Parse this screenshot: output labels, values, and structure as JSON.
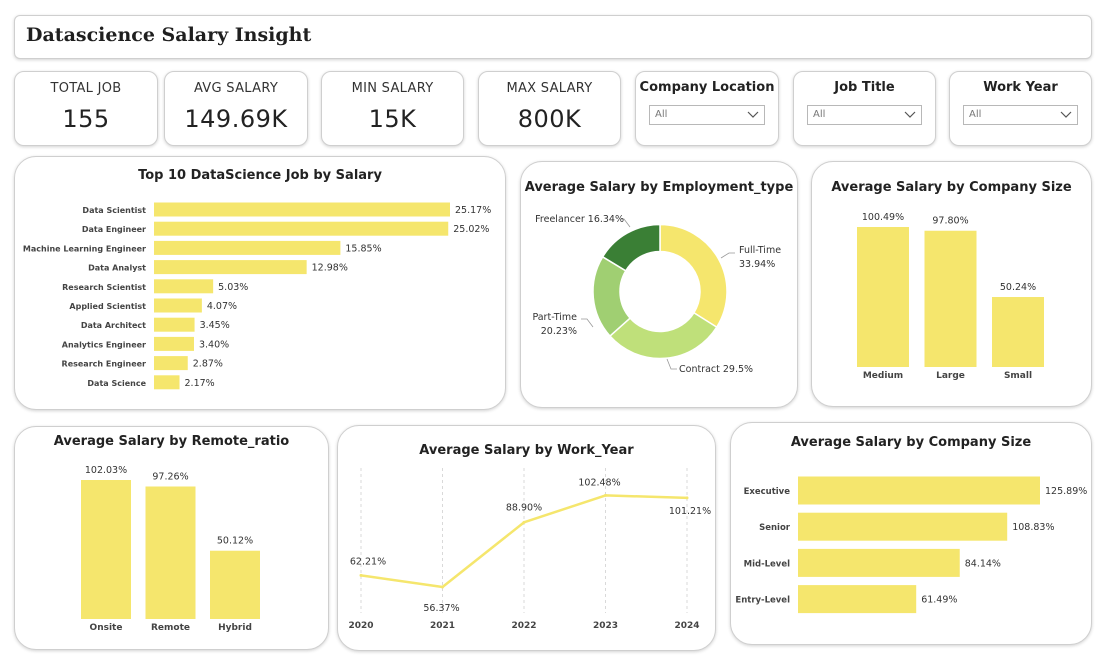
{
  "header": {
    "title": "Datascience Salary Insight"
  },
  "kpis": {
    "total_job": {
      "label": "TOTAL JOB",
      "value": "155"
    },
    "avg_salary": {
      "label": "AVG SALARY",
      "value": "149.69K"
    },
    "min_salary": {
      "label": "MIN SALARY",
      "value": "15K"
    },
    "max_salary": {
      "label": "MAX SALARY",
      "value": "800K"
    }
  },
  "slicers": {
    "company_location": {
      "label": "Company Location",
      "value": "All"
    },
    "job_title": {
      "label": "Job Title",
      "value": "All"
    },
    "work_year": {
      "label": "Work Year",
      "value": "All"
    }
  },
  "colors": {
    "bar": "#f5e66d",
    "line": "#f5e66d",
    "donut": [
      "#f5e66d",
      "#bfe07a",
      "#a0cf72",
      "#3a7f35"
    ]
  },
  "chart_data": [
    {
      "id": "top_jobs",
      "type": "bar",
      "orientation": "horizontal",
      "title": "Top 10 DataScience Job by Salary",
      "categories": [
        "Data Scientist",
        "Data Engineer",
        "Machine Learning Engineer",
        "Data Analyst",
        "Research Scientist",
        "Applied Scientist",
        "Data Architect",
        "Analytics Engineer",
        "Research Engineer",
        "Data Science"
      ],
      "values": [
        25.17,
        25.02,
        15.85,
        12.98,
        5.03,
        4.07,
        3.45,
        3.4,
        2.87,
        2.17
      ],
      "labels": [
        "25.17%",
        "25.02%",
        "15.85%",
        "12.98%",
        "5.03%",
        "4.07%",
        "3.45%",
        "3.40%",
        "2.87%",
        "2.17%"
      ]
    },
    {
      "id": "employment_type",
      "type": "pie",
      "title": "Average Salary by Employment_type",
      "categories": [
        "Full-Time",
        "Contract",
        "Part-Time",
        "Freelancer"
      ],
      "values": [
        33.94,
        29.5,
        20.23,
        16.34
      ],
      "labels": [
        "33.94%",
        "29.5%",
        "20.23%",
        "16.34%"
      ]
    },
    {
      "id": "company_size",
      "type": "bar",
      "title": "Average Salary by Company Size",
      "categories": [
        "Medium",
        "Large",
        "Small"
      ],
      "values": [
        100.49,
        97.8,
        50.24
      ],
      "labels": [
        "100.49%",
        "97.80%",
        "50.24%"
      ]
    },
    {
      "id": "remote_ratio",
      "type": "bar",
      "title": "Average Salary by Remote_ratio",
      "categories": [
        "Onsite",
        "Remote",
        "Hybrid"
      ],
      "values": [
        102.03,
        97.26,
        50.12
      ],
      "labels": [
        "102.03%",
        "97.26%",
        "50.12%"
      ]
    },
    {
      "id": "work_year",
      "type": "line",
      "title": "Average Salary by Work_Year",
      "x": [
        "2020",
        "2021",
        "2022",
        "2023",
        "2024"
      ],
      "values": [
        62.21,
        56.37,
        88.9,
        102.48,
        101.21
      ],
      "labels": [
        "62.21%",
        "56.37%",
        "88.90%",
        "102.48%",
        "101.21%"
      ]
    },
    {
      "id": "experience_level",
      "type": "bar",
      "orientation": "horizontal",
      "title": "Average Salary by Company Size",
      "categories": [
        "Executive",
        "Senior",
        "Mid-Level",
        "Entry-Level"
      ],
      "values": [
        125.89,
        108.83,
        84.14,
        61.49
      ],
      "labels": [
        "125.89%",
        "108.83%",
        "84.14%",
        "61.49%"
      ]
    }
  ]
}
